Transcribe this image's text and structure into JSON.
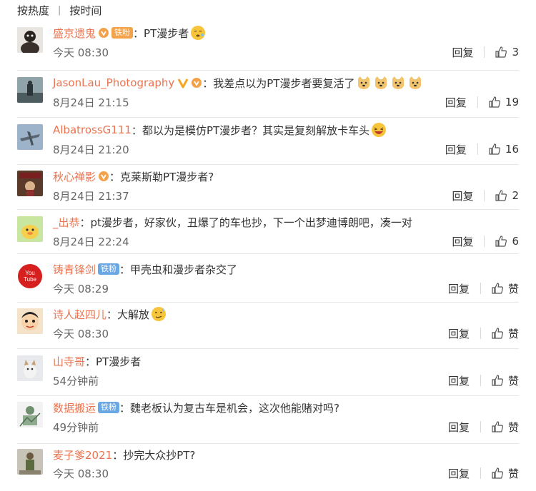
{
  "sort": {
    "hot": "按热度",
    "time": "按时间"
  },
  "comments": [
    {
      "user": "盛京遗鬼",
      "badge": "vip",
      "text": "PT漫步者",
      "emoji": "sleepy-emoji",
      "time": "今天 08:30",
      "reply": "回复",
      "likes": "3"
    },
    {
      "user": "JasonLau_Photography",
      "badge": "v-vip",
      "text": "我差点以为PT漫步者要复活了",
      "emoji": "dog-emoji x4",
      "time": "8月24日 21:15",
      "reply": "回复",
      "likes": "19"
    },
    {
      "user": "AlbatrossG111",
      "badge": "",
      "text": "都以为是模仿PT漫步者？其实是复刻解放卡车头",
      "emoji": "laughing-emoji",
      "time": "8月24日 21:20",
      "reply": "回复",
      "likes": "16"
    },
    {
      "user": "秋心禅影",
      "badge": "vip",
      "text": "克莱斯勒PT漫步者?",
      "emoji": "",
      "time": "8月24日 21:37",
      "reply": "回复",
      "likes": "2"
    },
    {
      "user": "_出恭",
      "badge": "",
      "text": "pt漫步者，好家伙，丑爆了的车也抄，下一个出梦迪博朗吧，凑一对",
      "emoji": "",
      "time": "8月24日 22:24",
      "reply": "回复",
      "likes": "6"
    },
    {
      "user": "铸青锋剑",
      "badge": "fan",
      "fan_label": "铁粉",
      "text": "甲壳虫和漫步者杂交了",
      "emoji": "",
      "time": "今天 08:29",
      "reply": "回复",
      "likes": "赞"
    },
    {
      "user": "诗人赵四儿",
      "badge": "",
      "text": "大解放",
      "emoji": "sweat-emoji",
      "time": "今天 08:30",
      "reply": "回复",
      "likes": "赞"
    },
    {
      "user": "山寺哥",
      "badge": "",
      "text": "PT漫步者",
      "emoji": "",
      "time": "54分钟前",
      "reply": "回复",
      "likes": "赞"
    },
    {
      "user": "数据搬运",
      "badge": "fan",
      "fan_label": "铁粉",
      "text": "魏老板认为复古车是机会，这次他能赌对吗?",
      "emoji": "",
      "time": "49分钟前",
      "reply": "回复",
      "likes": "赞"
    },
    {
      "user": "麦子爹2021",
      "badge": "",
      "text": "抄完大众抄PT?",
      "emoji": "",
      "time": "今天 08:30",
      "reply": "回复",
      "likes": "赞"
    }
  ],
  "colors": {
    "username": "#eb7350",
    "text": "#333333",
    "time": "#666666",
    "fan_badge": "#6aa8e5",
    "vip_badge": "#f3a24a"
  }
}
